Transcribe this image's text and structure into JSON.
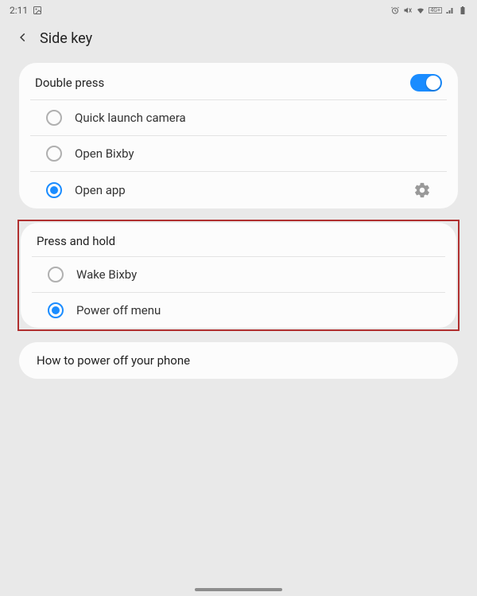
{
  "statusbar": {
    "time": "2:11"
  },
  "header": {
    "title": "Side key"
  },
  "double_press": {
    "title": "Double press",
    "toggle_on": true,
    "options": [
      {
        "label": "Quick launch camera",
        "checked": false
      },
      {
        "label": "Open Bixby",
        "checked": false
      },
      {
        "label": "Open app",
        "checked": true,
        "has_gear": true
      }
    ]
  },
  "press_hold": {
    "title": "Press and hold",
    "options": [
      {
        "label": "Wake Bixby",
        "checked": false
      },
      {
        "label": "Power off menu",
        "checked": true
      }
    ]
  },
  "help_link": {
    "label": "How to power off your phone"
  }
}
